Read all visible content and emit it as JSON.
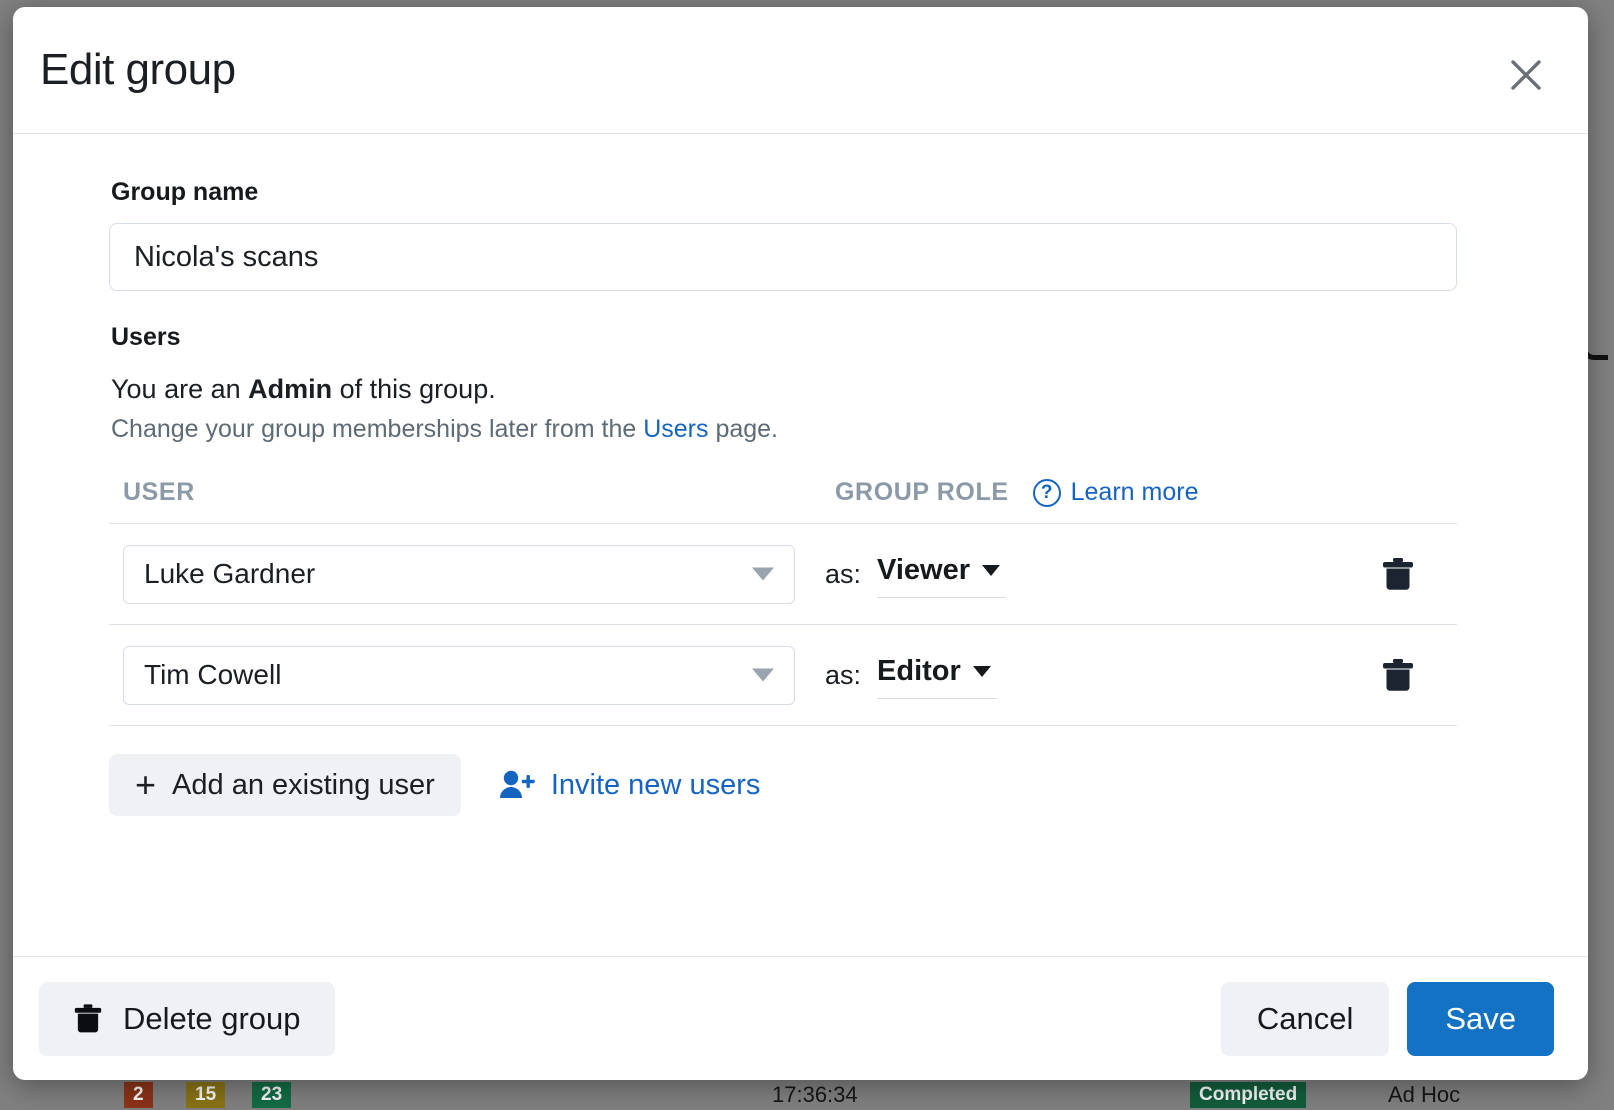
{
  "dialog": {
    "title": "Edit group",
    "close_icon": "close-icon"
  },
  "group_name": {
    "label": "Group name",
    "value": "Nicola's scans",
    "placeholder": "Group name"
  },
  "users_section": {
    "heading": "Users",
    "role_sentence_prefix": "You are an ",
    "role_sentence_role": "Admin",
    "role_sentence_suffix": " of this group.",
    "hint_prefix": "Change your group memberships later from the ",
    "hint_link": "Users",
    "hint_suffix": " page."
  },
  "table": {
    "header_user": "USER",
    "header_role": "GROUP ROLE",
    "help_icon_label": "?",
    "learn_more": "Learn more",
    "as_label": "as:",
    "rows": [
      {
        "user": "Luke Gardner",
        "role": "Viewer",
        "delete_icon": "trash-icon"
      },
      {
        "user": "Tim Cowell",
        "role": "Editor",
        "delete_icon": "trash-icon"
      }
    ]
  },
  "table_actions": {
    "add_existing_plus": "+",
    "add_existing_label": "Add an existing user",
    "invite_label": "Invite new users"
  },
  "footer": {
    "delete_label": "Delete group",
    "cancel_label": "Cancel",
    "save_label": "Save"
  },
  "colors": {
    "accent_blue": "#1565c0",
    "save_blue": "#1472c4",
    "button_grey": "#eff1f4",
    "muted_text": "#8c99a6",
    "backdrop": "#808080"
  },
  "background": {
    "badge_red": "2",
    "badge_olive": "15",
    "badge_green": "23",
    "timestamp": "17:36:34",
    "status_badge": "Completed",
    "type_label": "Ad Hoc"
  }
}
